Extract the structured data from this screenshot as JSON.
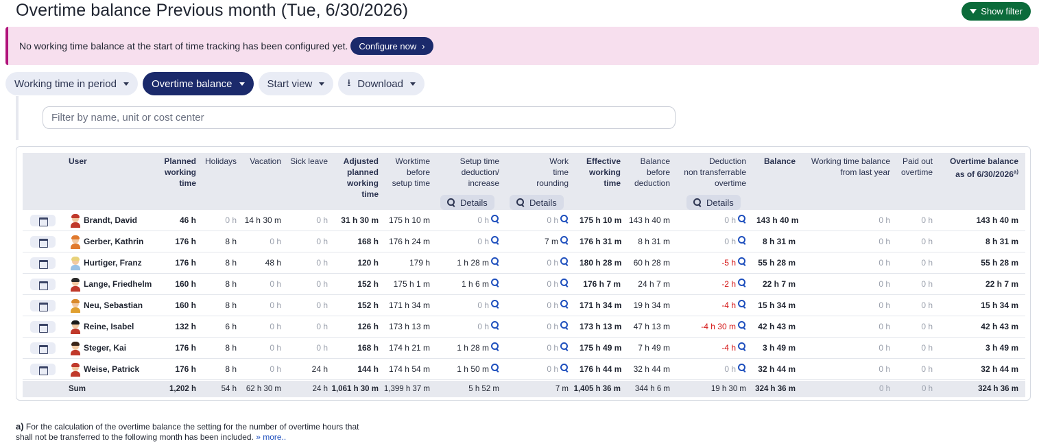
{
  "page": {
    "title": "Overtime balance Previous month (Tue, 6/30/2026)",
    "show_filter": "Show filter"
  },
  "alert": {
    "text": "No working time balance at the start of time tracking has been configured yet.",
    "button": "Configure now",
    "button_chevron": "›"
  },
  "toolbar": {
    "working_time": "Working time in period",
    "overtime_balance": "Overtime balance",
    "start_view": "Start view",
    "download": "Download",
    "download_icon": "⭳"
  },
  "filter": {
    "placeholder": "Filter by name, unit or cost center"
  },
  "columns": {
    "user": "User",
    "planned": [
      "Planned",
      "working",
      "time"
    ],
    "holidays": "Holidays",
    "vacation": "Vacation",
    "sick": "Sick leave",
    "adjusted": [
      "Adjusted",
      "planned",
      "working",
      "time"
    ],
    "worktime_before": [
      "Worktime",
      "before",
      "setup time"
    ],
    "setup": [
      "Setup time",
      "deduction/",
      "increase"
    ],
    "rounding": [
      "Work",
      "time",
      "rounding"
    ],
    "effective": [
      "Effective",
      "working",
      "time"
    ],
    "balance_before": [
      "Balance",
      "before",
      "deduction"
    ],
    "deduction": [
      "Deduction",
      "non transferrable",
      "overtime"
    ],
    "balance": "Balance",
    "wt_last_year": [
      "Working time balance",
      "from last year"
    ],
    "paid_out": [
      "Paid out",
      "overtime"
    ],
    "overtime": [
      "Overtime balance",
      "as of 6/30/2026"
    ],
    "overtime_sup": "a)",
    "details": "Details"
  },
  "rows": [
    {
      "name": "Brandt, David",
      "hair": "#c0392b",
      "shirt": "#c0392b",
      "planned": "46 h",
      "holidays": "0 h",
      "vacation": "14 h 30 m",
      "sick": "0 h",
      "adjusted": "31 h 30 m",
      "before": "175 h 10 m",
      "setup": "0 h",
      "rounding": "0 h",
      "effective": "175 h 10 m",
      "bal_before": "143 h 40 m",
      "deduction": "0 h",
      "balance": "143 h 40 m",
      "last_year": "0 h",
      "paid_out": "0 h",
      "overtime": "143 h 40 m"
    },
    {
      "name": "Gerber, Kathrin",
      "hair": "#e07a2e",
      "shirt": "#e07a2e",
      "planned": "176 h",
      "holidays": "8 h",
      "vacation": "0 h",
      "sick": "0 h",
      "adjusted": "168 h",
      "before": "176 h 24 m",
      "setup": "0 h",
      "rounding": "7 m",
      "effective": "176 h 31 m",
      "bal_before": "8 h 31 m",
      "deduction": "0 h",
      "balance": "8 h 31 m",
      "last_year": "0 h",
      "paid_out": "0 h",
      "overtime": "8 h 31 m"
    },
    {
      "name": "Hurtiger, Franz",
      "hair": "#e8d27a",
      "shirt": "#9ac2e6",
      "planned": "176 h",
      "holidays": "8 h",
      "vacation": "48 h",
      "sick": "0 h",
      "adjusted": "120 h",
      "before": "179 h",
      "setup": "1 h 28 m",
      "rounding": "0 h",
      "effective": "180 h 28 m",
      "bal_before": "60 h 28 m",
      "deduction": "-5 h",
      "balance": "55 h 28 m",
      "last_year": "0 h",
      "paid_out": "0 h",
      "overtime": "55 h 28 m"
    },
    {
      "name": "Lange, Friedhelm",
      "hair": "#2a2a2a",
      "shirt": "#c0392b",
      "planned": "160 h",
      "holidays": "8 h",
      "vacation": "0 h",
      "sick": "0 h",
      "adjusted": "152 h",
      "before": "175 h 1 m",
      "setup": "1 h 6 m",
      "rounding": "0 h",
      "effective": "176 h 7 m",
      "bal_before": "24 h 7 m",
      "deduction": "-2 h",
      "balance": "22 h 7 m",
      "last_year": "0 h",
      "paid_out": "0 h",
      "overtime": "22 h 7 m"
    },
    {
      "name": "Neu, Sebastian",
      "hair": "#d98a2b",
      "shirt": "#e0a030",
      "planned": "160 h",
      "holidays": "8 h",
      "vacation": "0 h",
      "sick": "0 h",
      "adjusted": "152 h",
      "before": "171 h 34 m",
      "setup": "0 h",
      "rounding": "0 h",
      "effective": "171 h 34 m",
      "bal_before": "19 h 34 m",
      "deduction": "-4 h",
      "balance": "15 h 34 m",
      "last_year": "0 h",
      "paid_out": "0 h",
      "overtime": "15 h 34 m"
    },
    {
      "name": "Reine, Isabel",
      "hair": "#1a1a1a",
      "shirt": "#c0392b",
      "planned": "132 h",
      "holidays": "6 h",
      "vacation": "0 h",
      "sick": "0 h",
      "adjusted": "126 h",
      "before": "173 h 13 m",
      "setup": "0 h",
      "rounding": "0 h",
      "effective": "173 h 13 m",
      "bal_before": "47 h 13 m",
      "deduction": "-4 h 30 m",
      "balance": "42 h 43 m",
      "last_year": "0 h",
      "paid_out": "0 h",
      "overtime": "42 h 43 m"
    },
    {
      "name": "Steger, Kai",
      "hair": "#3a2418",
      "shirt": "#c0392b",
      "planned": "176 h",
      "holidays": "8 h",
      "vacation": "0 h",
      "sick": "0 h",
      "adjusted": "168 h",
      "before": "174 h 21 m",
      "setup": "1 h 28 m",
      "rounding": "0 h",
      "effective": "175 h 49 m",
      "bal_before": "7 h 49 m",
      "deduction": "-4 h",
      "balance": "3 h 49 m",
      "last_year": "0 h",
      "paid_out": "0 h",
      "overtime": "3 h 49 m"
    },
    {
      "name": "Weise, Patrick",
      "hair": "#c0392b",
      "shirt": "#c0392b",
      "planned": "176 h",
      "holidays": "8 h",
      "vacation": "0 h",
      "sick": "24 h",
      "adjusted": "144 h",
      "before": "174 h 54 m",
      "setup": "1 h 50 m",
      "rounding": "0 h",
      "effective": "176 h 44 m",
      "bal_before": "32 h 44 m",
      "deduction": "0 h",
      "balance": "32 h 44 m",
      "last_year": "0 h",
      "paid_out": "0 h",
      "overtime": "32 h 44 m"
    }
  ],
  "sum": {
    "label": "Sum",
    "planned": "1,202 h",
    "holidays": "54 h",
    "vacation": "62 h 30 m",
    "sick": "24 h",
    "adjusted": "1,061 h 30 m",
    "before": "1,399 h 37 m",
    "setup": "5 h 52 m",
    "rounding": "7 m",
    "effective": "1,405 h 36 m",
    "bal_before": "344 h 6 m",
    "deduction": "19 h 30 m",
    "balance": "324 h 36 m",
    "last_year": "0 h",
    "paid_out": "0 h",
    "overtime": "324 h 36 m"
  },
  "footnote": {
    "marker": "a)",
    "text": " For the calculation of the overtime balance the setting for the number of overtime hours that shall not be transferred to the following month has been included.",
    "more": "» more.."
  },
  "colors": {
    "accent": "#1b2a6b",
    "filter_button": "#0b6b3a",
    "negative": "#d41414",
    "link": "#1e4fbd",
    "alert_bg": "#f7dfee"
  }
}
